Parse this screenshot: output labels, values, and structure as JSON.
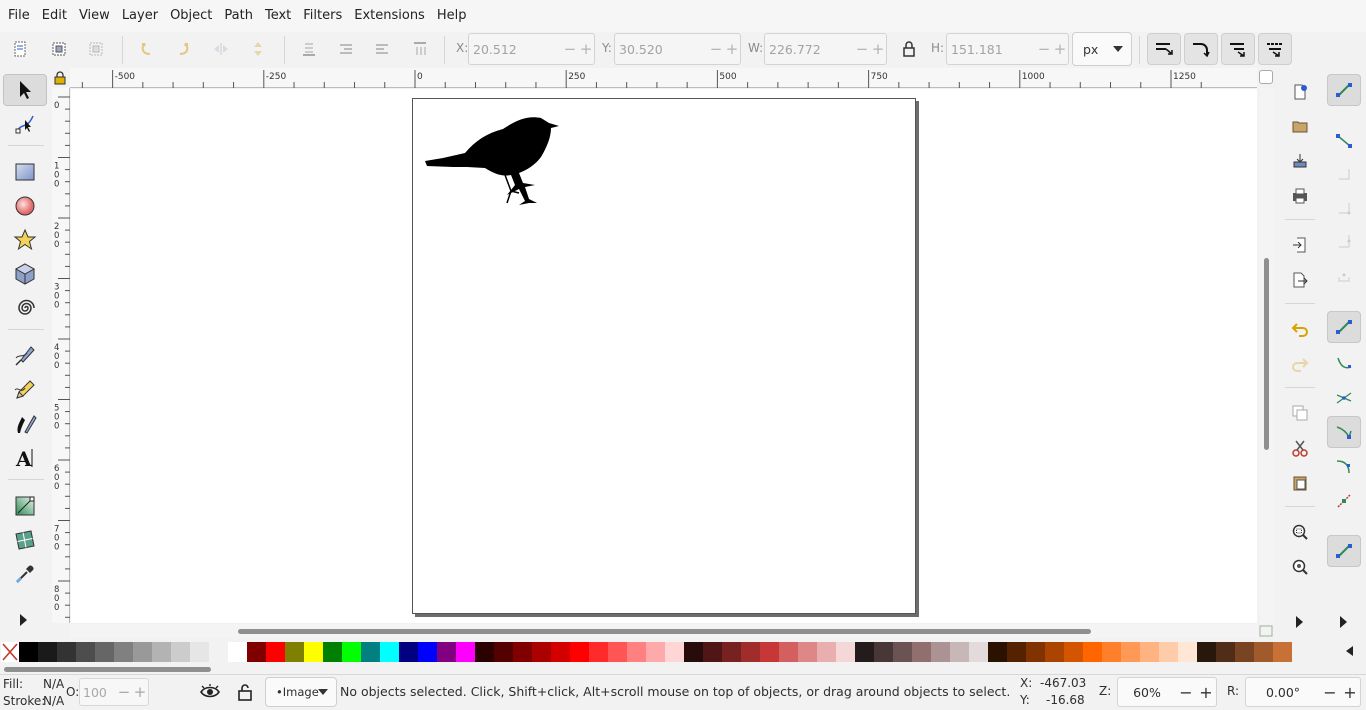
{
  "menu": [
    "File",
    "Edit",
    "View",
    "Layer",
    "Object",
    "Path",
    "Text",
    "Filters",
    "Extensions",
    "Help"
  ],
  "coords": {
    "x_label": "X:",
    "x_value": "20.512",
    "y_label": "Y:",
    "y_value": "30.520",
    "w_label": "W:",
    "w_value": "226.772",
    "h_label": "H:",
    "h_value": "151.181",
    "unit": "px"
  },
  "ruler": {
    "h_labels": [
      "-500",
      "-250",
      "0",
      "250",
      "500",
      "750",
      "1000",
      "1250"
    ],
    "v_labels": [
      "0",
      "100",
      "200",
      "300",
      "400",
      "500",
      "600",
      "700",
      "800"
    ]
  },
  "tools": [
    "selector-tool",
    "node-tool",
    "rectangle-tool",
    "ellipse-tool",
    "star-tool",
    "3d-box-tool",
    "spiral-tool",
    "pen-tool",
    "pencil-tool",
    "calligraphy-tool",
    "text-tool",
    "gradient-tool",
    "mesh-tool",
    "dropper-tool"
  ],
  "palette": [
    "#000000",
    "#1a1a1a",
    "#333333",
    "#4d4d4d",
    "#666666",
    "#808080",
    "#999999",
    "#b3b3b3",
    "#cccccc",
    "#e6e6e6",
    "#f2f2f2",
    "#ffffff",
    "#800000",
    "#ff0000",
    "#808000",
    "#ffff00",
    "#008000",
    "#00ff00",
    "#008080",
    "#00ffff",
    "#000080",
    "#0000ff",
    "#800080",
    "#ff00ff",
    "#2b0000",
    "#550000",
    "#800000",
    "#aa0000",
    "#d40000",
    "#ff0000",
    "#ff2a2a",
    "#ff5555",
    "#ff8080",
    "#ffaaaa",
    "#ffd5d5",
    "#280b0b",
    "#501616",
    "#782121",
    "#a02c2c",
    "#c83737",
    "#d35f5f",
    "#de8787",
    "#e9afaf",
    "#f4d7d7",
    "#241c1c",
    "#483737",
    "#6c5353",
    "#916f6f",
    "#ac9393",
    "#c8b7b7",
    "#e3dbdb",
    "#2b1100",
    "#552200",
    "#803300",
    "#aa4400",
    "#d45500",
    "#ff6600",
    "#ff7f2a",
    "#ff9955",
    "#ffb380",
    "#ffccaa",
    "#ffe6d5",
    "#28170b",
    "#502d16",
    "#784421",
    "#a05a2c",
    "#c87137"
  ],
  "status": {
    "fill_label": "Fill:",
    "fill_value": "N/A",
    "stroke_label": "Stroke:",
    "stroke_value": "N/A",
    "opacity_label": "O:",
    "opacity_value": "100",
    "layer": "•Image",
    "message": "No objects selected. Click, Shift+click, Alt+scroll mouse on top of objects, or drag around objects to select.",
    "cursor_x_label": "X:",
    "cursor_x": "-467.03",
    "cursor_y_label": "Y:",
    "cursor_y": "-16.68",
    "zoom_label": "Z:",
    "zoom": "60%",
    "rotate_label": "R:",
    "rotate": "0.00°"
  },
  "colors": {
    "accent_green": "#2e8b57",
    "accent_blue": "#2f5bd1",
    "undo_yellow": "#d8a200"
  }
}
